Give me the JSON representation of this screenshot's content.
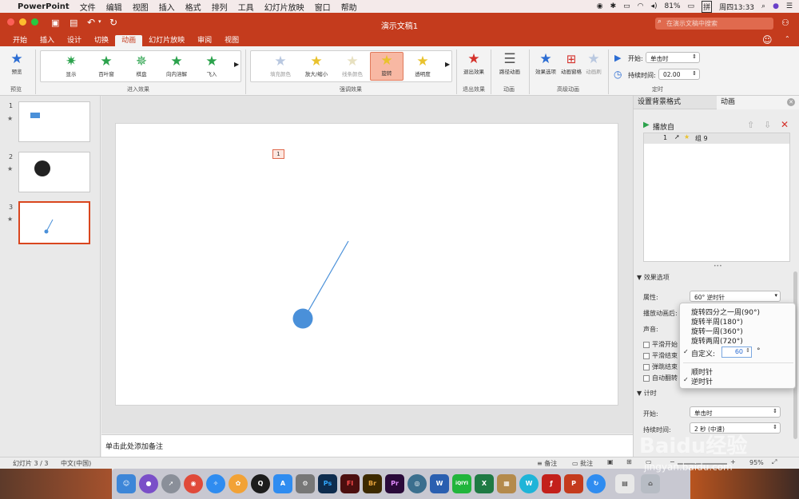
{
  "menubar": {
    "app_name": "PowerPoint",
    "items": [
      "文件",
      "编辑",
      "视图",
      "插入",
      "格式",
      "排列",
      "工具",
      "幻灯片放映",
      "窗口",
      "帮助"
    ],
    "battery": "81%",
    "clock": "周四13:33"
  },
  "titlebar": {
    "title": "演示文稿1",
    "search_placeholder": "在演示文稿中搜索"
  },
  "tabs": [
    "开始",
    "插入",
    "设计",
    "切换",
    "动画",
    "幻灯片放映",
    "审阅",
    "视图"
  ],
  "ribbon": {
    "preview": "预览",
    "preview_group": "预览",
    "entrance": [
      "显示",
      "百叶窗",
      "棋盘",
      "向内溶解",
      "飞入"
    ],
    "entrance_group": "进入效果",
    "emphasis": [
      "填充颜色",
      "放大/缩小",
      "线条颜色",
      "旋转",
      "透明度"
    ],
    "emphasis_group": "强调效果",
    "exit_button": "退出效果",
    "exit_group": "退出效果",
    "path_button": "路径动画",
    "path_group": "动画",
    "effect_options": "效果选项",
    "anim_pane": "动画窗格",
    "reorder": "动画刷",
    "advanced_group": "高级动画",
    "start_label": "开始:",
    "start_value": "单击时",
    "duration_label": "持续时间:",
    "duration_value": "02.00",
    "timing_group": "定时"
  },
  "slides": [
    {
      "number": "1",
      "star": "★"
    },
    {
      "number": "2",
      "star": "★"
    },
    {
      "number": "3",
      "star": "★"
    }
  ],
  "canvas": {
    "anim_tag": "1"
  },
  "notes": {
    "placeholder": "单击此处添加备注"
  },
  "statusbar": {
    "slide_info": "幻灯片 3 / 3",
    "language": "中文(中国)",
    "notes_button": "备注",
    "comments_button": "批注",
    "zoom": "95%"
  },
  "pane": {
    "tab_background": "设置背景格式",
    "tab_animation": "动画",
    "play_from": "播放自",
    "anim_item": {
      "index": "1",
      "name": "组 9"
    },
    "effect_section": "效果选项",
    "property_label": "属性:",
    "property_value": "60° 逆时针",
    "after_anim_label": "播放动画后:",
    "sound_label": "声音:",
    "checkboxes": [
      "平滑开始",
      "平滑结束",
      "弹跳结束",
      "自动翻转"
    ],
    "timing_section": "计时",
    "start_label": "开始:",
    "start_value": "单击时",
    "duration_label": "持续时间:",
    "duration_value": "2 秒 (中速)"
  },
  "dropdown": {
    "items": [
      "旋转四分之一周(90°)",
      "旋转半周(180°)",
      "旋转一周(360°)",
      "旋转两周(720°)"
    ],
    "custom_label": "自定义:",
    "custom_value": "60",
    "degree": "°",
    "clockwise": "顺时针",
    "counterclockwise": "逆时针",
    "check": "✓"
  },
  "dock": {
    "apps": [
      "Ps",
      "Fl",
      "Br",
      "Pr",
      "W",
      "iQIYI",
      "X",
      "W",
      "P"
    ]
  },
  "watermark": {
    "text": "Baidu经验",
    "url": "jingyan.baidu.com"
  },
  "colors": {
    "accent": "#c43b1d",
    "shape_blue": "#4a90d9"
  }
}
